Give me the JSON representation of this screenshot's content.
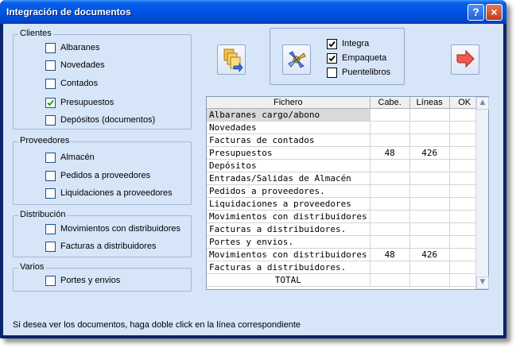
{
  "window": {
    "title": "Integración de documentos",
    "help_label": "?",
    "close_label": "×"
  },
  "groups": {
    "clientes": {
      "label": "Clientes",
      "items": [
        {
          "label": "Albaranes",
          "checked": false
        },
        {
          "label": "Novedades",
          "checked": false
        },
        {
          "label": "Contados",
          "checked": false
        },
        {
          "label": "Presupuestos",
          "checked": true
        },
        {
          "label": "Depósitos (documentos)",
          "checked": false
        }
      ]
    },
    "proveedores": {
      "label": "Proveedores",
      "items": [
        {
          "label": "Almacén",
          "checked": false
        },
        {
          "label": "Pedidos a proveedores",
          "checked": false
        },
        {
          "label": "Liquidaciones a proveedores",
          "checked": false
        }
      ]
    },
    "distribucion": {
      "label": "Distribución",
      "items": [
        {
          "label": "Movimientos con distribuidores",
          "checked": false
        },
        {
          "label": "Facturas a distribuidores",
          "checked": false
        }
      ]
    },
    "varios": {
      "label": "Varios",
      "items": [
        {
          "label": "Portes y envios",
          "checked": false
        }
      ]
    }
  },
  "options": [
    {
      "label": "Integra",
      "checked": true
    },
    {
      "label": "Empaqueta",
      "checked": true
    },
    {
      "label": "Puentelibros",
      "checked": false
    }
  ],
  "toolbar": {
    "documents_icon": "documents-icon",
    "package_icon": "package-icon",
    "exit_icon": "exit-arrow-icon"
  },
  "grid": {
    "columns": [
      "Fichero",
      "Cabe.",
      "Líneas",
      "OK"
    ],
    "rows": [
      {
        "fichero": "Albaranes cargo/abono",
        "cabe": "",
        "lineas": "",
        "ok": "",
        "highlight": true
      },
      {
        "fichero": "Novedades",
        "cabe": "",
        "lineas": "",
        "ok": ""
      },
      {
        "fichero": "Facturas de contados",
        "cabe": "",
        "lineas": "",
        "ok": ""
      },
      {
        "fichero": "Presupuestos",
        "cabe": "48",
        "lineas": "426",
        "ok": ""
      },
      {
        "fichero": "Depósitos",
        "cabe": "",
        "lineas": "",
        "ok": ""
      },
      {
        "fichero": "Entradas/Salidas de Almacén",
        "cabe": "",
        "lineas": "",
        "ok": ""
      },
      {
        "fichero": "Pedidos a proveedores.",
        "cabe": "",
        "lineas": "",
        "ok": ""
      },
      {
        "fichero": "Liquidaciones a proveedores",
        "cabe": "",
        "lineas": "",
        "ok": ""
      },
      {
        "fichero": "Movimientos con distribuidores",
        "cabe": "",
        "lineas": "",
        "ok": ""
      },
      {
        "fichero": "Facturas a distribuidores.",
        "cabe": "",
        "lineas": "",
        "ok": ""
      },
      {
        "fichero": "Portes y envios.",
        "cabe": "",
        "lineas": "",
        "ok": ""
      },
      {
        "fichero": "Movimientos con distribuidores",
        "cabe": "48",
        "lineas": "426",
        "ok": ""
      },
      {
        "fichero": "Facturas a distribuidores.",
        "cabe": "",
        "lineas": "",
        "ok": ""
      },
      {
        "fichero": "TOTAL",
        "cabe": "",
        "lineas": "",
        "ok": "",
        "total": true
      }
    ]
  },
  "footer": {
    "hint": "Si desea ver los documentos, haga doble click en la línea correspondiente"
  },
  "colors": {
    "title_bar": "#0054e3",
    "client_bg": "#d7e5f9",
    "group_border": "#a5b8d6",
    "highlight_row": "#d9d9d9",
    "check_mark": "#21a121"
  }
}
